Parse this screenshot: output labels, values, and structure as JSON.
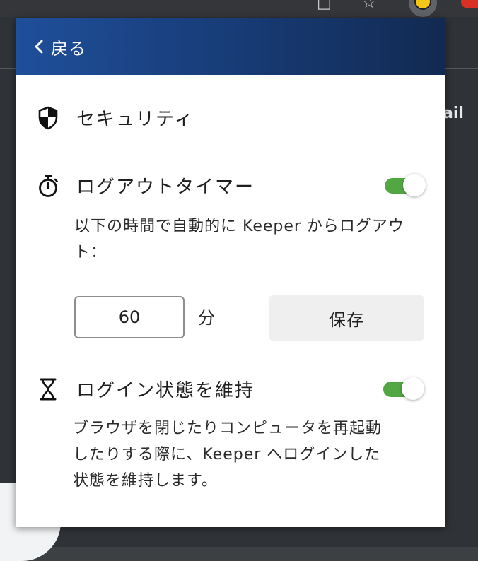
{
  "header": {
    "back_label": "戻る"
  },
  "page_behind": {
    "peek_text": "ail"
  },
  "security": {
    "title": "セキュリティ",
    "icon": "shield-icon"
  },
  "logout_timer": {
    "title": "ログアウトタイマー",
    "icon": "stopwatch-icon",
    "enabled": true,
    "description": "以下の時間で自動的に Keeper からログアウト：",
    "minutes_value": "60",
    "unit_label": "分",
    "save_label": "保存"
  },
  "stay_logged_in": {
    "title": "ログイン状態を維持",
    "icon": "hourglass-icon",
    "enabled": true,
    "description": "ブラウザを閉じたりコンピュータを再起動したりする際に、Keeper へログインした状態を維持します。"
  },
  "colors": {
    "header_start": "#1f4f9a",
    "header_end": "#122a52",
    "toggle_on": "#52a742"
  }
}
